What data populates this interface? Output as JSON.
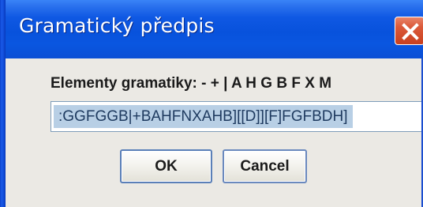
{
  "window": {
    "title": "Gramatický předpis"
  },
  "dialog": {
    "label": "Elementy gramatiky: - + | A H G B F X M",
    "input_value": ":GGFGGB|+BAHFNXAHB][[D]][F]FGFBDH]",
    "ok_label": "OK",
    "cancel_label": "Cancel"
  },
  "icons": {
    "close": "close-icon"
  },
  "colors": {
    "titlebar": "#0852dc",
    "close_button": "#d95535",
    "dialog_bg": "#ebe9e4",
    "selection": "#b8cfe5",
    "button_border": "#5a7fb8"
  }
}
